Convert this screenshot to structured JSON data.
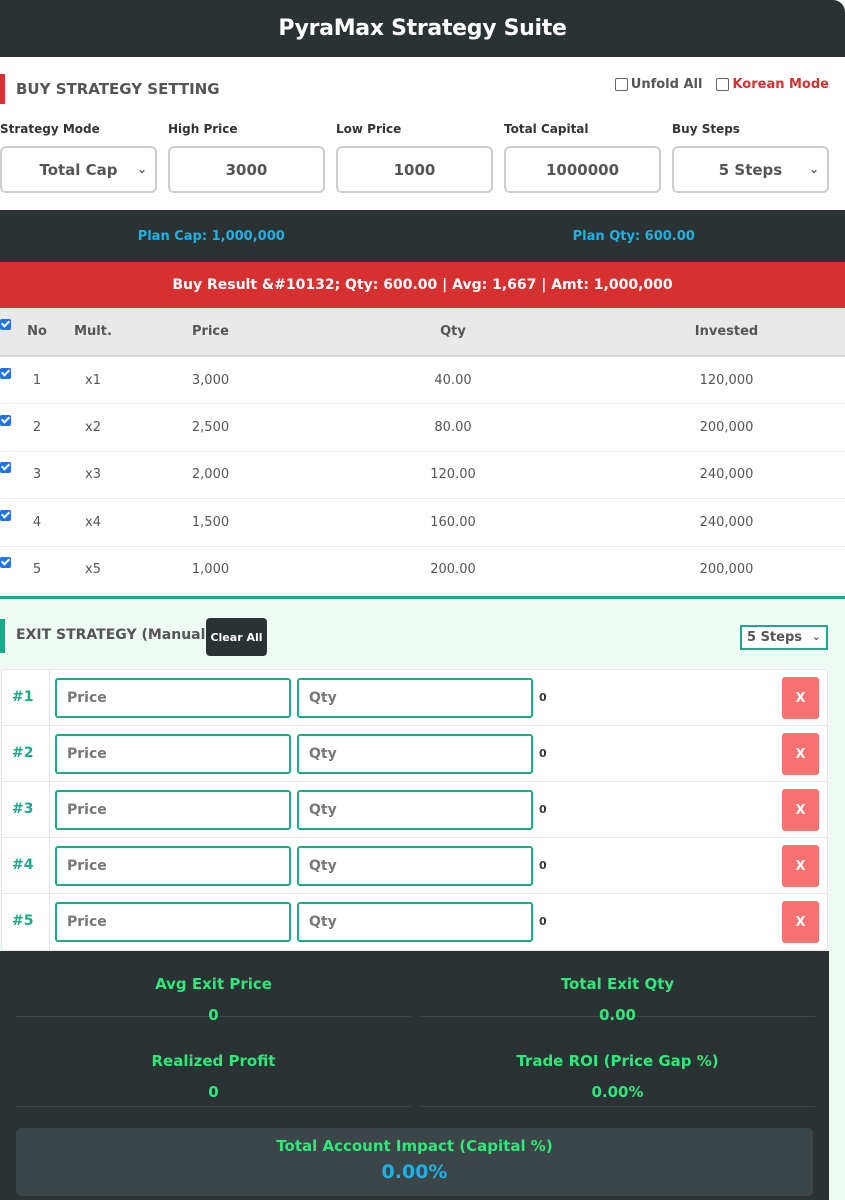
{
  "app": {
    "title": "PyraMax Strategy Suite"
  },
  "buy_setting": {
    "title": "BUY STRATEGY SETTING",
    "unfold_all_label": "Unfold All",
    "korean_mode_label": "Korean Mode",
    "fields": {
      "strategy_mode": {
        "label": "Strategy Mode",
        "value": "Total Cap"
      },
      "high_price": {
        "label": "High Price",
        "value": "3000"
      },
      "low_price": {
        "label": "Low Price",
        "value": "1000"
      },
      "total_capital": {
        "label": "Total Capital",
        "value": "1000000"
      },
      "buy_steps": {
        "label": "Buy Steps",
        "value": "5 Steps"
      }
    }
  },
  "plan": {
    "cap_label": "Plan Cap:",
    "cap_value": "1,000,000",
    "qty_label": "Plan Qty:",
    "qty_value": "600.00"
  },
  "buy_result": {
    "text": "Buy Result &#10132; Qty: 600.00 | Avg: 1,667 | Amt: 1,000,000"
  },
  "buy_table": {
    "headers": [
      "No",
      "Mult.",
      "Price",
      "Qty",
      "Invested"
    ],
    "rows": [
      {
        "no": "1",
        "mult": "x1",
        "price": "3,000",
        "qty": "40.00",
        "invested": "120,000"
      },
      {
        "no": "2",
        "mult": "x2",
        "price": "2,500",
        "qty": "80.00",
        "invested": "200,000"
      },
      {
        "no": "3",
        "mult": "x3",
        "price": "2,000",
        "qty": "120.00",
        "invested": "240,000"
      },
      {
        "no": "4",
        "mult": "x4",
        "price": "1,500",
        "qty": "160.00",
        "invested": "240,000"
      },
      {
        "no": "5",
        "mult": "x5",
        "price": "1,000",
        "qty": "200.00",
        "invested": "200,000"
      }
    ]
  },
  "exit": {
    "title": "EXIT STRATEGY (Manual)",
    "clear_all_label": "Clear All",
    "steps_value": "5 Steps",
    "rows": [
      {
        "num": "#1",
        "price_placeholder": "Price",
        "qty_placeholder": "Qty",
        "value": "0",
        "remove_label": "X"
      },
      {
        "num": "#2",
        "price_placeholder": "Price",
        "qty_placeholder": "Qty",
        "value": "0",
        "remove_label": "X"
      },
      {
        "num": "#3",
        "price_placeholder": "Price",
        "qty_placeholder": "Qty",
        "value": "0",
        "remove_label": "X"
      },
      {
        "num": "#4",
        "price_placeholder": "Price",
        "qty_placeholder": "Qty",
        "value": "0",
        "remove_label": "X"
      },
      {
        "num": "#5",
        "price_placeholder": "Price",
        "qty_placeholder": "Qty",
        "value": "0",
        "remove_label": "X"
      }
    ]
  },
  "summary": {
    "avg_exit_price": {
      "label": "Avg Exit Price",
      "value": "0"
    },
    "total_exit_qty": {
      "label": "Total Exit Qty",
      "value": "0.00"
    },
    "realized_profit": {
      "label": "Realized Profit",
      "value": "0"
    },
    "trade_roi": {
      "label": "Trade ROI (Price Gap %)",
      "value": "0.00%"
    },
    "account_impact": {
      "label": "Total Account Impact (Capital %)",
      "value": "0.00%"
    }
  },
  "colors": {
    "dark": "#2b3234",
    "red": "#d63031",
    "teal": "#1aab8a",
    "green_text": "#2ee87a",
    "blue_text": "#1ab3e6",
    "remove_button": "#f87171"
  }
}
